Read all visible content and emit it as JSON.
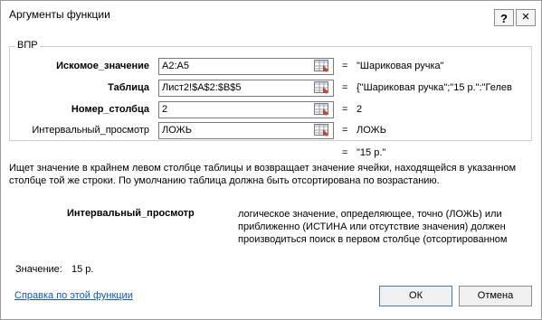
{
  "window": {
    "title": "Аргументы функции"
  },
  "titlebar": {
    "help_label": "?",
    "close_label": "×"
  },
  "group": {
    "label": "ВПР"
  },
  "arguments": [
    {
      "label": "Искомое_значение",
      "bold": true,
      "value": "A2:A5",
      "result": "\"Шариковая ручка\""
    },
    {
      "label": "Таблица",
      "bold": true,
      "value": "Лист2!$A$2:$B$5",
      "result": "{\"Шариковая ручка\";\"15 р.\":\"Гелев"
    },
    {
      "label": "Номер_столбца",
      "bold": true,
      "value": "2",
      "result": "2"
    },
    {
      "label": "Интервальный_просмотр",
      "bold": false,
      "value": "ЛОЖЬ",
      "result": "ЛОЖЬ"
    }
  ],
  "equals_sign": "=",
  "formula_result": "\"15 р.\"",
  "description": "Ищет значение в крайнем левом столбце таблицы и возвращает значение ячейки, находящейся в указанном столбце той же строки. По умолчанию таблица должна быть отсортирована по возрастанию.",
  "arg_description": {
    "label": "Интервальный_просмотр",
    "text": "логическое значение, определяющее, точно (ЛОЖЬ) или приближенно (ИСТИНА или отсутствие значения) должен производиться поиск в первом столбце (отсортированном по"
  },
  "value_row": {
    "label": "Значение:",
    "value": "15 р."
  },
  "help_link": "Справка по этой функции",
  "buttons": {
    "ok": "ОК",
    "cancel": "Отмена"
  }
}
